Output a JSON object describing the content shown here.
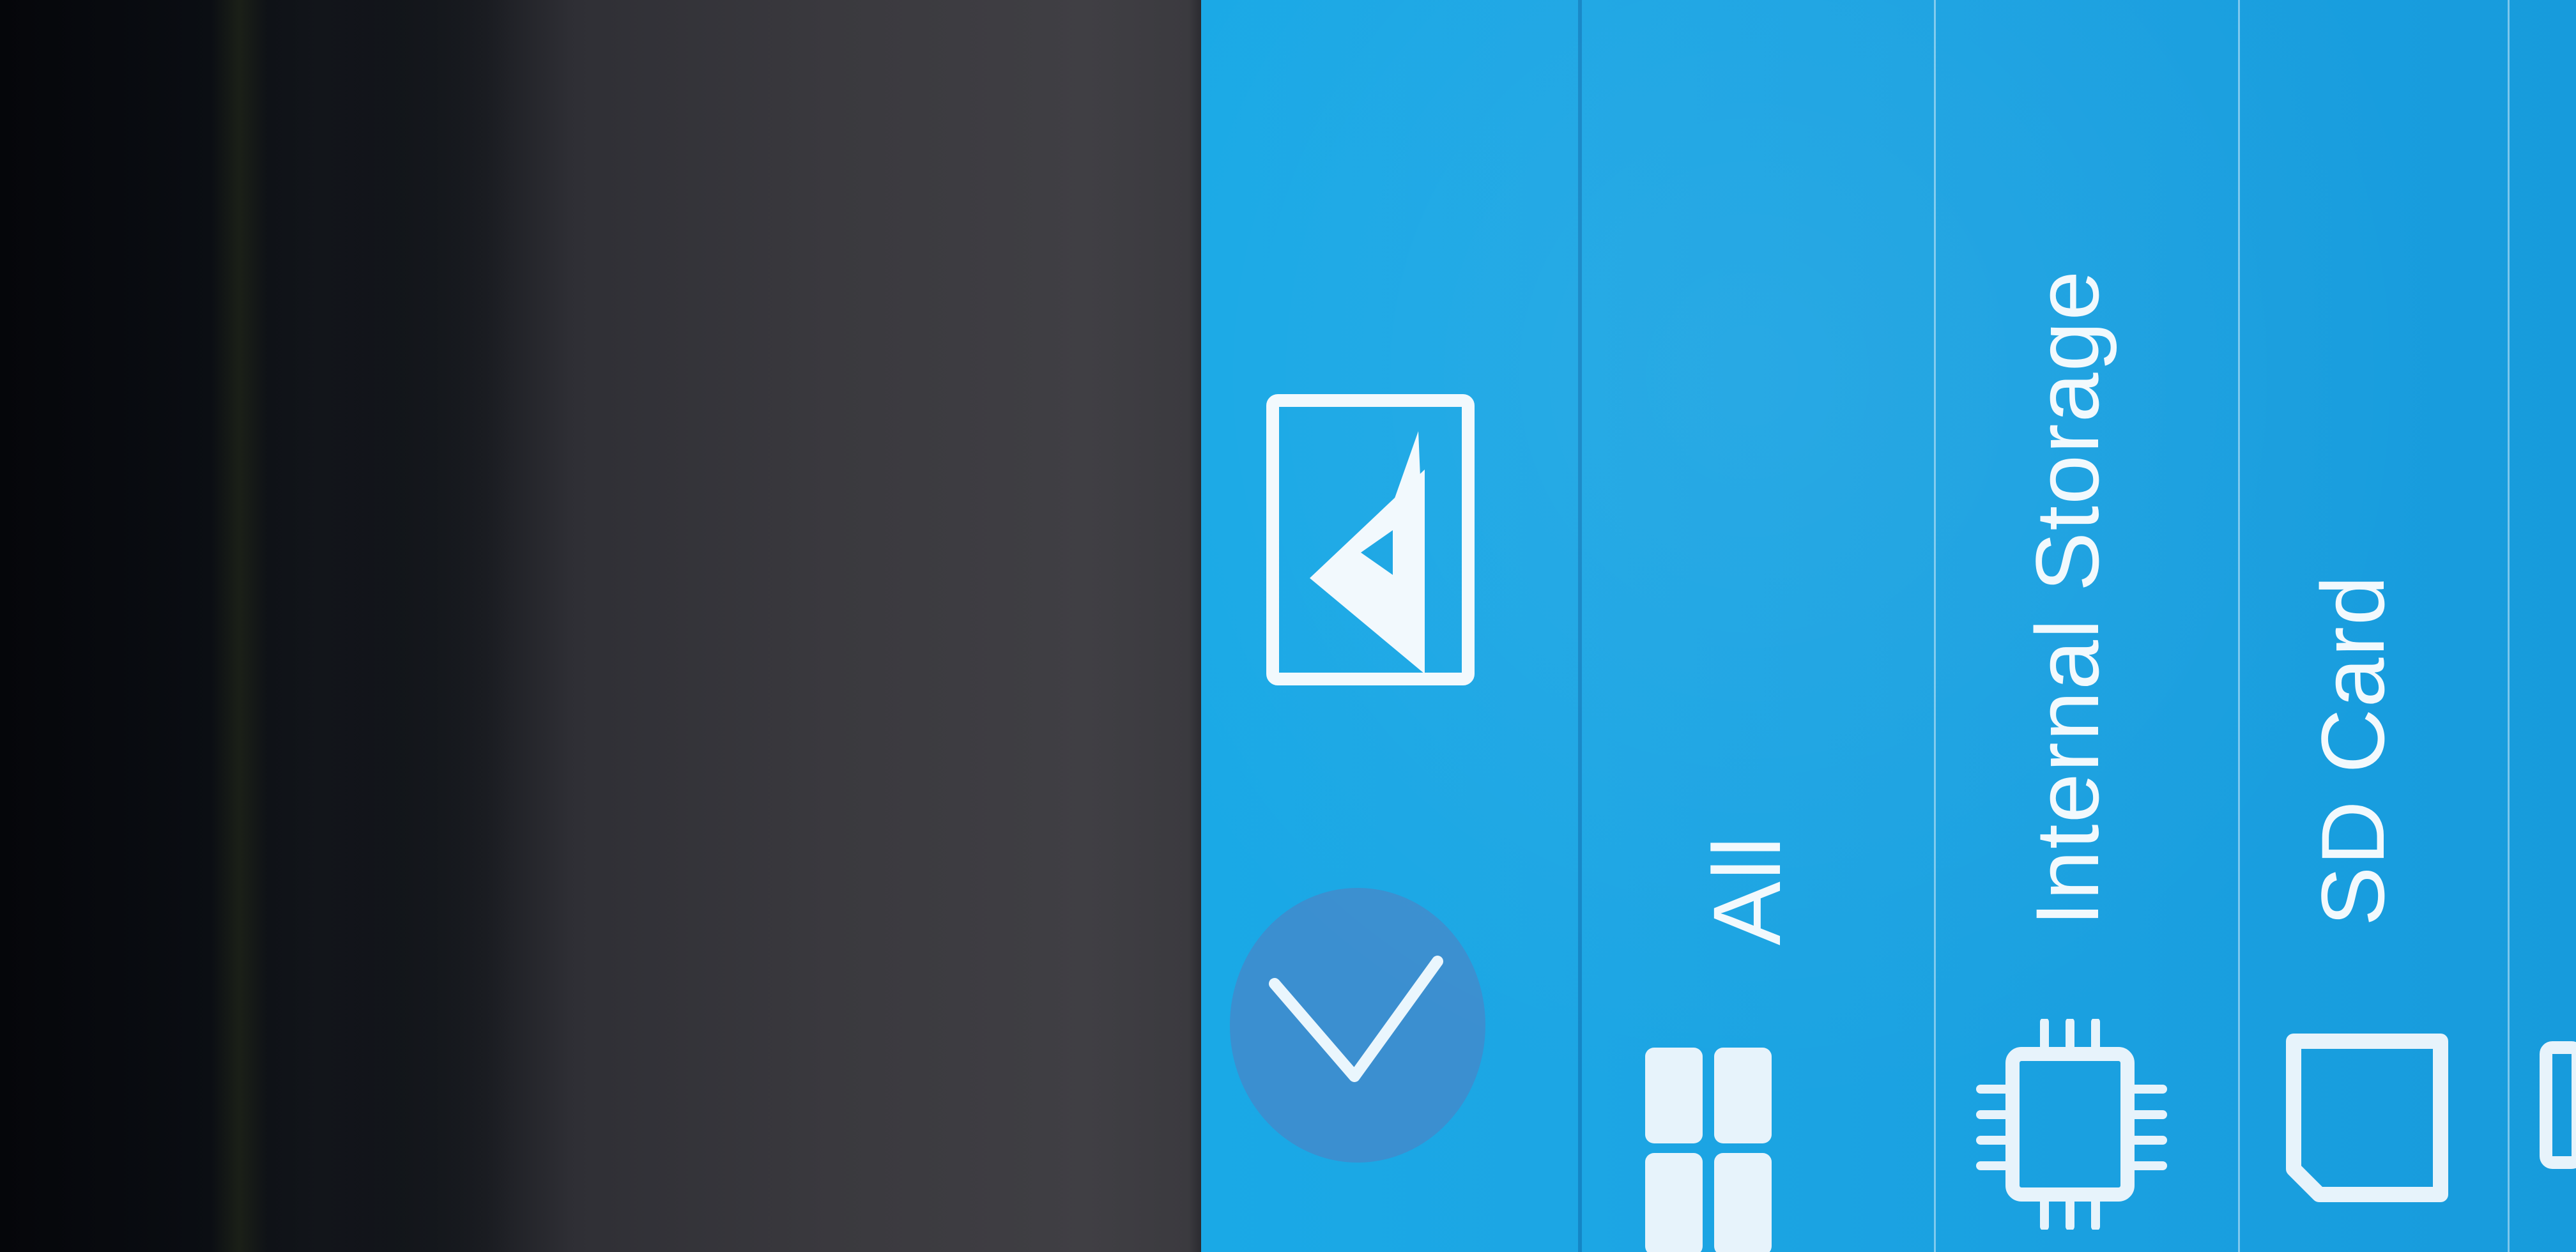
{
  "toolbar": {
    "gallery_icon": "image-icon",
    "confirm_icon": "chevron-down-icon"
  },
  "filters": [
    {
      "label": "All",
      "icon": "grid-icon"
    },
    {
      "label": "Internal Storage",
      "icon": "chip-icon"
    },
    {
      "label": "SD Card",
      "icon": "sd-card-icon"
    }
  ],
  "colors": {
    "screen_blue": "#1aa6e4",
    "confirm_circle": "#3b8fd0",
    "text": "#f2f9fd"
  }
}
